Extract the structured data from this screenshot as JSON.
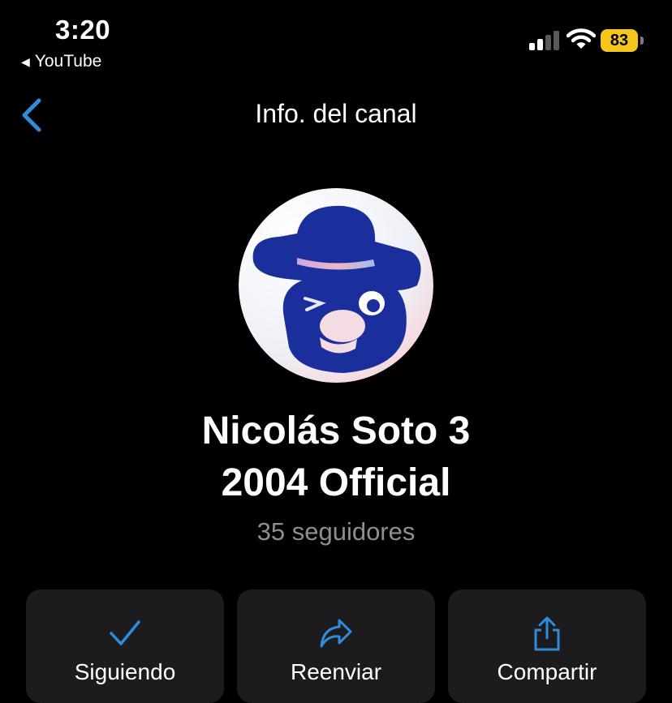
{
  "status_bar": {
    "time": "3:20",
    "back_app": "YouTube",
    "battery_level": "83",
    "battery_color": "#f4c51c"
  },
  "nav": {
    "back_icon": "chevron-left-icon",
    "title": "Info. del canal",
    "accent_color": "#2f8cdb"
  },
  "channel": {
    "name_line1": "Nicolás Soto 3",
    "name_line2": "2004 Official",
    "followers": "35 seguidores",
    "avatar_icon": "channel-avatar-character-with-hat"
  },
  "actions": [
    {
      "label": "Siguiendo",
      "icon": "checkmark-icon"
    },
    {
      "label": "Reenviar",
      "icon": "forward-arrow-icon"
    },
    {
      "label": "Compartir",
      "icon": "share-icon"
    }
  ]
}
